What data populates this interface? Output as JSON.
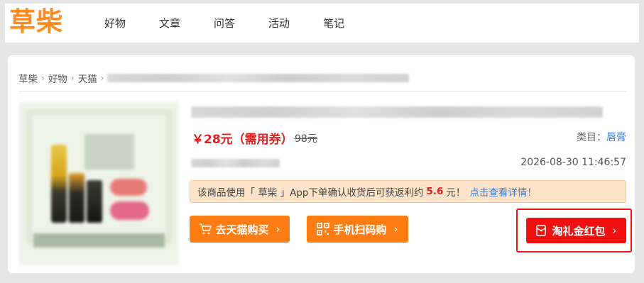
{
  "header": {
    "logo": "草柴",
    "nav": [
      "好物",
      "文章",
      "问答",
      "活动",
      "笔记"
    ]
  },
  "breadcrumb": {
    "items": [
      "草柴",
      "好物",
      "天猫"
    ],
    "separator": "›"
  },
  "product": {
    "price": "￥28元（需用券）",
    "original_price": "98元",
    "category_label": "类目：",
    "category_value": "唇膏",
    "datetime": "2026-08-30 11:46:57"
  },
  "notice": {
    "prefix": "该商品使用「 草柴 」App下单确认收货后可获返利约",
    "amount": "5.6",
    "suffix": "元！",
    "link": "点击查看详情！"
  },
  "buttons": {
    "tmall_buy": "去天猫购买",
    "scan_buy": "手机扫码购",
    "red_packet": "淘礼金红包",
    "chevron": "›"
  },
  "colors": {
    "brand_orange": "#ff8a1f",
    "button_orange": "#ff7d12",
    "price_red": "#e02020",
    "red_button": "#f01010",
    "link_blue": "#3a7bd5"
  }
}
